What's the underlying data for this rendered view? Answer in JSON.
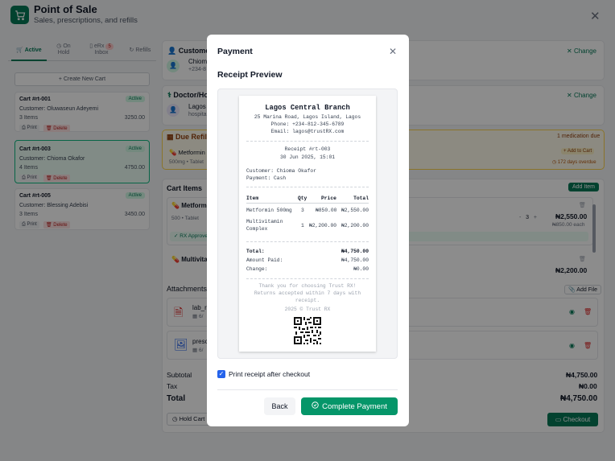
{
  "app": {
    "title": "Point of Sale",
    "subtitle": "Sales, prescriptions, and refills"
  },
  "left": {
    "tabs": [
      {
        "label": "Active"
      },
      {
        "label_line1": "On",
        "label_line2": "Hold"
      },
      {
        "label_line1": "eRx",
        "label_line2": "Inbox",
        "badge": "5"
      },
      {
        "label": "Refills"
      }
    ],
    "new_cart_label": "+ Create New Cart",
    "carts": [
      {
        "id": "Cart #rt-001",
        "status": "Active",
        "customer": "Customer: Oluwaseun Adeyemi",
        "items": "3 Items",
        "total": "3250.00",
        "print": "Print",
        "delete": "Delete"
      },
      {
        "id": "Cart #rt-003",
        "status": "Active",
        "customer": "Customer: Chioma Okafor",
        "items": "4 Items",
        "total": "4750.00",
        "print": "Print",
        "delete": "Delete"
      },
      {
        "id": "Cart #rt-005",
        "status": "Active",
        "customer": "Customer: Blessing Adebisi",
        "items": "3 Items",
        "total": "3450.00",
        "print": "Print",
        "delete": "Delete"
      }
    ]
  },
  "right": {
    "customer_title": "Customer",
    "customer_name": "Chioma Okafor",
    "customer_phone": "+234-8",
    "change_label": "Change",
    "doctor_title": "Doctor/Hospital",
    "doctor_name": "Lagos",
    "doctor_hospital": "hospital",
    "change2_label": "Change",
    "due_refills_title": "Due Refills",
    "due_count": "1 medication due",
    "refill_item": "Metformin",
    "refill_meta": "500mg • Tablet",
    "add_to_cart": "Add to Cart",
    "overdue": "172 days overdue",
    "cart_items_title": "Cart Items",
    "add_item": "Add Item",
    "item1_name": "Metformin",
    "item1_meta": "500 • Tablet",
    "item1_qty": "3",
    "item1_total": "₦2,550.00",
    "item1_each": "₦850.00 each",
    "rx_approved": "RX Approved",
    "item2_name": "Multivitamin",
    "item2_total": "₦2,200.00",
    "attachments_title": "Attachments",
    "add_file": "Add File",
    "file1": "lab_r",
    "file1_date": "6/",
    "file2": "presc",
    "file2_date": "6/",
    "subtotal_label": "Subtotal",
    "subtotal": "₦4,750.00",
    "tax_label": "Tax",
    "tax": "₦0.00",
    "total_label": "Total",
    "total": "₦4,750.00",
    "hold_cart": "Hold Cart",
    "checkout": "Checkout"
  },
  "modal": {
    "title": "Payment",
    "subtitle": "Receipt Preview",
    "receipt": {
      "store": "Lagos Central Branch",
      "address": "25 Marina Road, Lagos Island, Lagos",
      "phone": "Phone: +234-812-345-6789",
      "email": "Email: lagos@trustRX.com",
      "receipt_no": "Receipt #rt-003",
      "datetime": "30 Jun 2025, 15:01",
      "customer": "Customer: Chioma Okafor",
      "payment": "Payment: Cash",
      "col_item": "Item",
      "col_qty": "Qty",
      "col_price": "Price",
      "col_total": "Total",
      "rows": [
        {
          "item": "Metformin 500mg",
          "qty": "3",
          "price": "₦850.00",
          "total": "₦2,550.00"
        },
        {
          "item_line1": "Multivitamin",
          "item_line2": "Complex",
          "qty": "1",
          "price": "₦2,200.00",
          "total": "₦2,200.00"
        }
      ],
      "total_label": "Total:",
      "total": "₦4,750.00",
      "paid_label": "Amount Paid:",
      "paid": "₦4,750.00",
      "change_label": "Change:",
      "change": "₦0.00",
      "thanks1": "Thank you for choosing Trust RX!",
      "thanks2": "Returns accepted within 7 days with",
      "thanks3": "receipt.",
      "copyright": "2025 © Trust RX"
    },
    "print_after_label": "Print receipt after checkout",
    "back_label": "Back",
    "complete_label": "Complete Payment"
  }
}
